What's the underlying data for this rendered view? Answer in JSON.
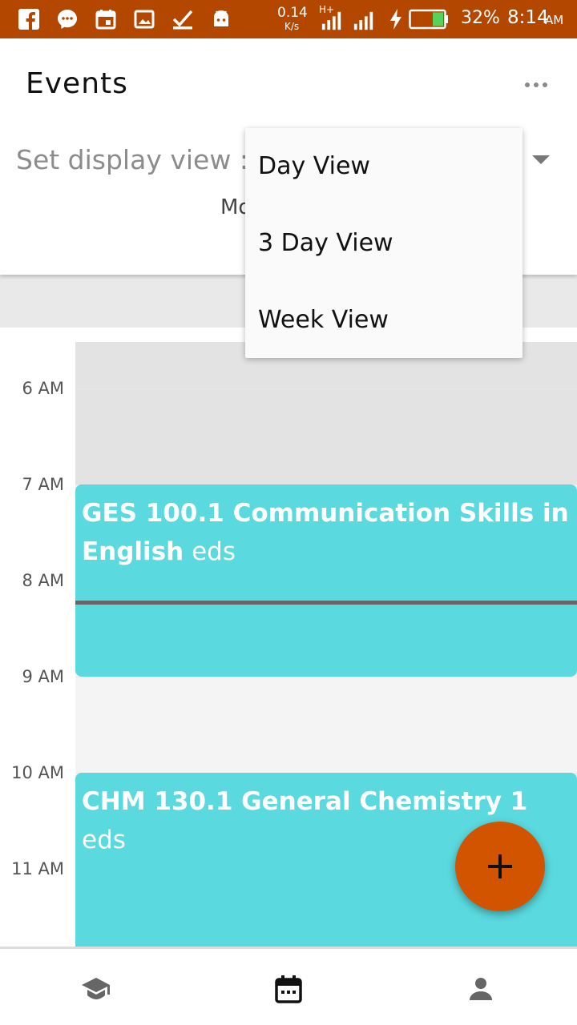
{
  "status_bar": {
    "net_speed_value": "0.14",
    "net_speed_unit": "K/s",
    "network_type": "H+",
    "battery_percent": "32%",
    "time": "8:14",
    "time_suffix": "AM",
    "background_color": "#b34700"
  },
  "app_bar": {
    "title": "Events",
    "display_label": "Set display view :",
    "display_value_partial": "Mo"
  },
  "dropdown": {
    "items": [
      "Day View",
      "3 Day View",
      "Week View"
    ]
  },
  "calendar": {
    "hours": [
      "6 AM",
      "7 AM",
      "8 AM",
      "9 AM",
      "10 AM",
      "11 AM"
    ],
    "events": [
      {
        "title": "GES 100.1 Communication Skills in English",
        "suffix": " eds",
        "color": "#5ad9df"
      },
      {
        "title": "CHM 130.1 General Chemistry 1",
        "suffix": " eds",
        "color": "#5ad9df"
      }
    ]
  },
  "fab": {
    "icon": "plus-icon",
    "color": "#d35400"
  },
  "bottom_nav": {
    "items": [
      {
        "icon": "graduation-cap-icon"
      },
      {
        "icon": "calendar-icon",
        "active": true
      },
      {
        "icon": "person-icon"
      }
    ]
  }
}
